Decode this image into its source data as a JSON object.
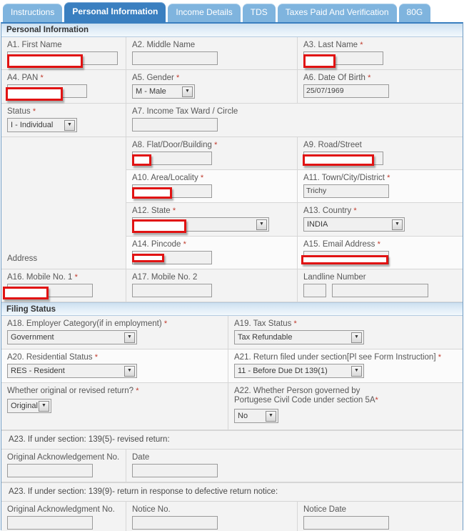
{
  "tabs": [
    {
      "label": "Instructions",
      "active": false
    },
    {
      "label": "Personal Information",
      "active": true
    },
    {
      "label": "Income Details",
      "active": false
    },
    {
      "label": "TDS",
      "active": false
    },
    {
      "label": "Taxes Paid And Verification",
      "active": false
    },
    {
      "label": "80G",
      "active": false
    }
  ],
  "sections": {
    "personal_information": "Personal Information",
    "filing_status": "Filing Status"
  },
  "fields": {
    "a1_first_name": {
      "label": "A1. First Name",
      "required": false,
      "value": "",
      "redacted": true
    },
    "a2_middle_name": {
      "label": "A2. Middle Name",
      "required": false,
      "value": "",
      "redacted": false
    },
    "a3_last_name": {
      "label": "A3. Last Name",
      "required": true,
      "value": "",
      "redacted": true
    },
    "a4_pan": {
      "label": "A4. PAN",
      "required": true,
      "value": "",
      "redacted": true
    },
    "a5_gender": {
      "label": "A5. Gender",
      "required": true,
      "value": "M - Male"
    },
    "a6_dob": {
      "label": "A6. Date Of Birth",
      "required": true,
      "value": "25/07/1969"
    },
    "status": {
      "label": "Status",
      "required": true,
      "value": "I - Individual"
    },
    "a7_ward": {
      "label": "A7. Income Tax Ward / Circle",
      "required": false,
      "value": ""
    },
    "address_label": "Address",
    "a8_flat": {
      "label": "A8. Flat/Door/Building",
      "required": true,
      "value": "",
      "redacted": true
    },
    "a9_road": {
      "label": "A9. Road/Street",
      "required": false,
      "value": "",
      "redacted": true
    },
    "a10_area": {
      "label": "A10. Area/Locality",
      "required": true,
      "value": "",
      "redacted": true
    },
    "a11_town": {
      "label": "A11. Town/City/District",
      "required": true,
      "value": "Trichy"
    },
    "a12_state": {
      "label": "A12. State",
      "required": true,
      "value": "",
      "redacted": true
    },
    "a13_country": {
      "label": "A13. Country",
      "required": true,
      "value": "INDIA"
    },
    "a14_pincode": {
      "label": "A14. Pincode",
      "required": true,
      "value": "",
      "redacted": true
    },
    "a15_email": {
      "label": "A15. Email Address",
      "required": true,
      "value": "",
      "redacted": true
    },
    "a16_mobile1": {
      "label": "A16. Mobile No. 1",
      "required": true,
      "value": "",
      "redacted": true
    },
    "a17_mobile2": {
      "label": "A17. Mobile No. 2",
      "required": false,
      "value": ""
    },
    "landline": {
      "label": "Landline Number",
      "required": false,
      "std_value": "",
      "value": ""
    },
    "a18_employer": {
      "label": "A18. Employer Category(if in employment)",
      "required": true,
      "value": "Government"
    },
    "a19_tax_status": {
      "label": "A19. Tax Status",
      "required": true,
      "value": "Tax Refundable"
    },
    "a20_residential": {
      "label": "A20. Residential Status",
      "required": true,
      "value": "RES - Resident"
    },
    "a21_section": {
      "label": "A21. Return filed under section[Pl see Form Instruction]",
      "required": true,
      "value": "11 - Before Due Dt 139(1)"
    },
    "orig_or_revised": {
      "label": "Whether original or revised return?",
      "required": true,
      "value": "Original"
    },
    "a22_portugese": {
      "label_line1": "A22. Whether Person governed by",
      "label_line2": "Portugese Civil Code under section 5A",
      "required": true,
      "value": "No"
    },
    "a23_revised_heading": "A23. If under section: 139(5)- revised return:",
    "a23_orig_ack_1": {
      "label": "Original Acknowledgement No.",
      "value": ""
    },
    "a23_date": {
      "label": "Date",
      "value": ""
    },
    "a23_defective_heading": "A23. If under section: 139(9)- return in response to defective return notice:",
    "a23_orig_ack_2": {
      "label": "Original Acknowledgment No.",
      "value": ""
    },
    "a23_notice_no": {
      "label": "Notice No.",
      "value": ""
    },
    "a23_notice_date": {
      "label": "Notice Date",
      "value": ""
    }
  },
  "colors": {
    "tab_active": "#3a7fc0",
    "tab_inactive": "#7fb4de",
    "redaction": "#e11313",
    "required_star": "#c0392b"
  },
  "icons": {
    "dropdown_arrow": "chevron-down-icon"
  }
}
